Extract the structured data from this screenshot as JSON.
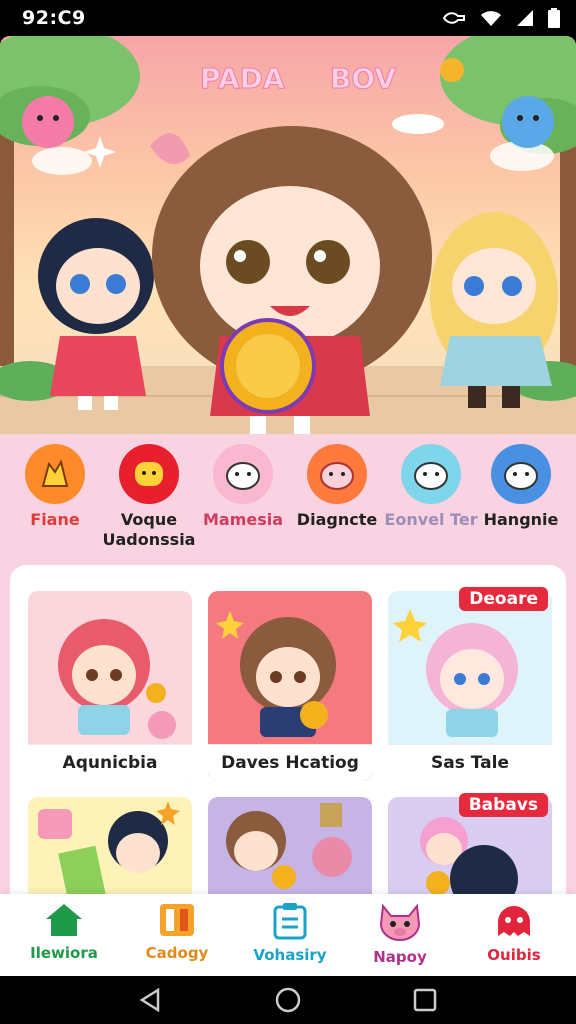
{
  "status": {
    "time": "92:C9"
  },
  "hero": {
    "title_left": "PADA",
    "title_right": "BOV"
  },
  "categories": [
    {
      "label": "Fiane",
      "color": "#e23b3b",
      "icon": "cat-face-icon",
      "bg": "#ff8a2a"
    },
    {
      "label": "Voque\nUadonssia",
      "color": "#222222",
      "icon": "cat-face-icon",
      "bg": "#e8202e"
    },
    {
      "label": "Mamesia",
      "color": "#d23b5c",
      "icon": "cat-face-icon",
      "bg": "#f9b7d0"
    },
    {
      "label": "Diagncte",
      "color": "#222222",
      "icon": "pig-face-icon",
      "bg": "#ff7a3c"
    },
    {
      "label": "Eonvel Ter",
      "color": "#9a8fb8",
      "icon": "cat-face-icon",
      "bg": "#7fd5ea"
    },
    {
      "label": "Hangnie",
      "color": "#222222",
      "icon": "cat-face-icon",
      "bg": "#4a90e2"
    }
  ],
  "cards": [
    {
      "title": "Aqunicbia",
      "tag": ""
    },
    {
      "title": "Daves Hcatiog",
      "tag": ""
    },
    {
      "title": "Sas Tale",
      "tag": "Deoare"
    },
    {
      "title": "",
      "tag": ""
    },
    {
      "title": "",
      "tag": ""
    },
    {
      "title": "",
      "tag": "Babavs"
    }
  ],
  "tabs": [
    {
      "label": "Ilewiora",
      "color": "#1f9a4a"
    },
    {
      "label": "Cadogy",
      "color": "#e08a1a"
    },
    {
      "label": "Vohasiry",
      "color": "#1aa3c8"
    },
    {
      "label": "Napoy",
      "color": "#b0308c"
    },
    {
      "label": "Ouibis",
      "color": "#e0253c"
    }
  ],
  "colors": {
    "panel_bg": "#f9d3e1",
    "accent_red": "#e52a3d"
  }
}
